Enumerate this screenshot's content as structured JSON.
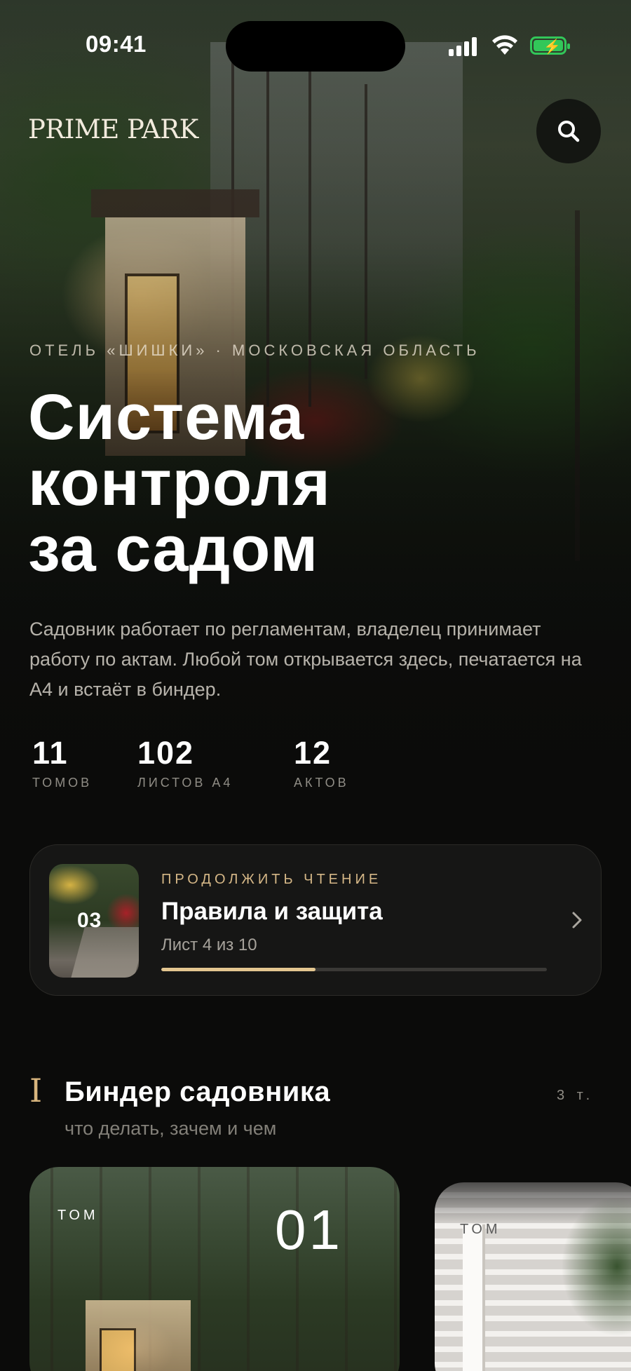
{
  "status_bar": {
    "time": "09:41"
  },
  "header": {
    "logo": "PRIME PARK"
  },
  "hero": {
    "kicker": "ОТЕЛЬ «ШИШКИ» · МОСКОВСКАЯ ОБЛАСТЬ",
    "title_lines": [
      "Система",
      "контроля",
      "за садом"
    ],
    "description": "Садовник работает по регламентам, владелец принимает работу по актам. Любой том открывается здесь, печатается на А4 и встаёт в биндер."
  },
  "stats": [
    {
      "value": "11",
      "label": "ТОМОВ"
    },
    {
      "value": "102",
      "label": "ЛИСТОВ А4"
    },
    {
      "value": "12",
      "label": "АКТОВ"
    }
  ],
  "continue_reading": {
    "kicker": "ПРОДОЛЖИТЬ ЧТЕНИЕ",
    "volume_number": "03",
    "title": "Правила и защита",
    "subtitle": "Лист 4 из 10",
    "progress": 0.4
  },
  "section": {
    "numeral": "I",
    "title": "Биндер садовника",
    "count": "3 т.",
    "subtitle": "что делать, зачем и чем"
  },
  "volumes": [
    {
      "label": "ТОМ",
      "number": "01"
    },
    {
      "label": "ТОМ",
      "number": ""
    }
  ],
  "colors": {
    "accent": "#d8b57e",
    "progress": "#e3c690",
    "battery": "#32c759",
    "background": "#0b0b0a"
  },
  "icons": {
    "search": "search-icon",
    "chevron": "chevron-right-icon",
    "signal": "signal-icon",
    "wifi": "wifi-icon",
    "battery": "battery-charging-icon"
  }
}
